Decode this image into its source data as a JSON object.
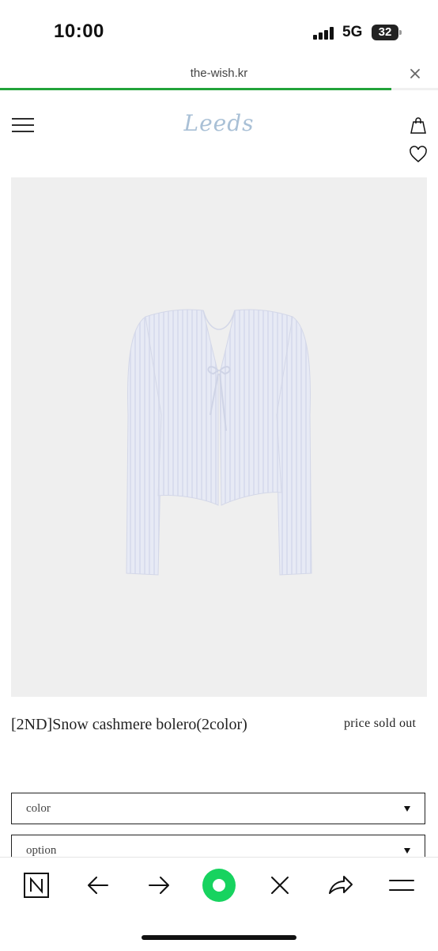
{
  "status_bar": {
    "time": "10:00",
    "network": "5G",
    "battery": "32"
  },
  "browser": {
    "url": "the-wish.kr",
    "load_progress": 0.893
  },
  "site": {
    "logo": "Leeds"
  },
  "product": {
    "name": "[2ND]Snow cashmere bolero(2color)",
    "price": "price sold out",
    "options": [
      {
        "label": "color"
      },
      {
        "label": "option"
      }
    ]
  },
  "toolbar": {
    "icons": [
      "n-icon",
      "back-arrow-icon",
      "forward-arrow-icon",
      "green-circle-icon",
      "close-icon",
      "share-icon",
      "menu-icon"
    ]
  },
  "colors": {
    "accent_green": "#22a33a",
    "logo_blue": "#a9c0d6",
    "garment": "#e6e9f4"
  }
}
